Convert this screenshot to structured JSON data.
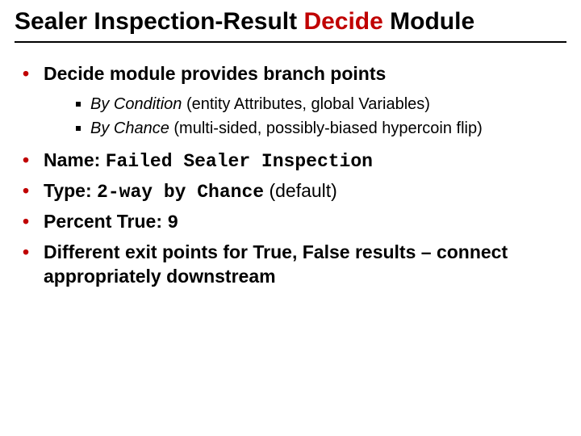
{
  "title": {
    "pre": "Sealer Inspection-Result ",
    "accent": "Decide",
    "post": " Module"
  },
  "bullets": {
    "b1": {
      "text": "Decide module provides branch points",
      "sub": [
        {
          "em": "By Condition",
          "rest": " (entity Attributes, global Variables)"
        },
        {
          "em": "By Chance",
          "rest": " (multi-sided, possibly-biased hypercoin flip)"
        }
      ]
    },
    "b2": {
      "label": "Name: ",
      "value": "Failed Sealer Inspection"
    },
    "b3": {
      "label": "Type: ",
      "value": "2-way by Chance",
      "suffix": " (default)"
    },
    "b4": {
      "label": "Percent True: ",
      "value": "9"
    },
    "b5": {
      "text": "Different exit points for True, False results – connect appropriately downstream"
    }
  }
}
